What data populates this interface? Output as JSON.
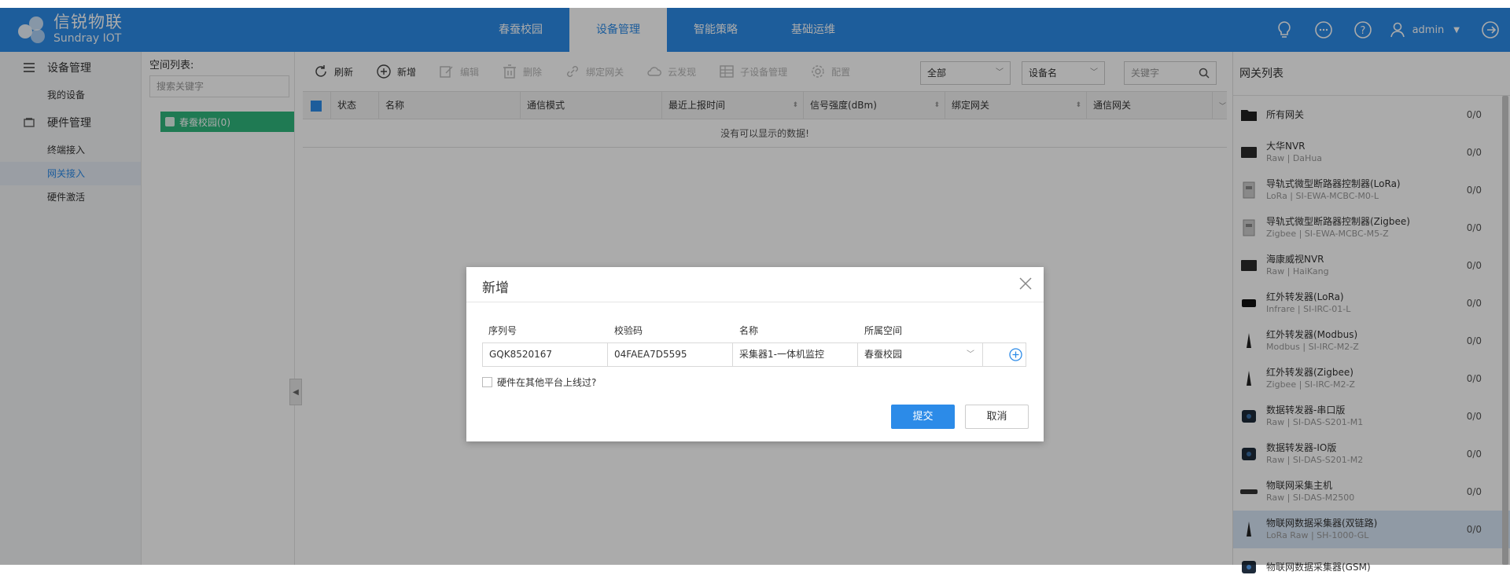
{
  "brand": {
    "name_cn": "信锐物联",
    "name_en": "Sundray IOT"
  },
  "nav": {
    "tabs": [
      "春蚕校园",
      "设备管理",
      "智能策略",
      "基础运维"
    ],
    "active": 1
  },
  "user": {
    "name": "admin"
  },
  "sidebar": {
    "groups": [
      {
        "label": "设备管理",
        "items": [
          "我的设备"
        ]
      },
      {
        "label": "硬件管理",
        "items": [
          "终端接入",
          "网关接入",
          "硬件激活"
        ]
      }
    ],
    "active_item": "网关接入"
  },
  "tree": {
    "title": "空间列表:",
    "search_placeholder": "搜索关键字",
    "node": "春蚕校园(0)"
  },
  "toolbar": {
    "refresh": "刷新",
    "add": "新增",
    "edit": "编辑",
    "delete": "删除",
    "bind_gateway": "绑定网关",
    "cloud_issue": "云发现",
    "sub_device": "子设备管理",
    "config": "配置",
    "filter_all": "全部",
    "filter_field": "设备名",
    "keyword_placeholder": "关键字"
  },
  "table": {
    "columns": [
      "状态",
      "名称",
      "通信模式",
      "最近上报时间",
      "信号强度(dBm)",
      "绑定网关",
      "通信网关"
    ],
    "empty_text": "没有可以显示的数据!"
  },
  "gateway_panel": {
    "title": "网关列表",
    "items": [
      {
        "name": "所有网关",
        "sub": "",
        "count": "0/0"
      },
      {
        "name": "大华NVR",
        "sub": "Raw | DaHua",
        "count": "0/0"
      },
      {
        "name": "导轨式微型断路器控制器(LoRa)",
        "sub": "LoRa | SI-EWA-MCBC-M0-L",
        "count": "0/0"
      },
      {
        "name": "导轨式微型断路器控制器(Zigbee)",
        "sub": "Zigbee | SI-EWA-MCBC-M5-Z",
        "count": "0/0"
      },
      {
        "name": "海康威视NVR",
        "sub": "Raw | HaiKang",
        "count": "0/0"
      },
      {
        "name": "红外转发器(LoRa)",
        "sub": "Infrare | SI-IRC-01-L",
        "count": "0/0"
      },
      {
        "name": "红外转发器(Modbus)",
        "sub": "Modbus | SI-IRC-M2-Z",
        "count": "0/0"
      },
      {
        "name": "红外转发器(Zigbee)",
        "sub": "Zigbee | SI-IRC-M2-Z",
        "count": "0/0"
      },
      {
        "name": "数据转发器-串口版",
        "sub": "Raw | SI-DAS-S201-M1",
        "count": "0/0"
      },
      {
        "name": "数据转发器-IO版",
        "sub": "Raw | SI-DAS-S201-M2",
        "count": "0/0"
      },
      {
        "name": "物联网采集主机",
        "sub": "Raw | SI-DAS-M2500",
        "count": "0/0"
      },
      {
        "name": "物联网数据采集器(双链路)",
        "sub": "LoRa Raw | SH-1000-GL",
        "count": "0/0"
      },
      {
        "name": "物联网数据采集器(GSM)",
        "sub": "",
        "count": ""
      }
    ],
    "selected": 11
  },
  "dialog": {
    "title": "新增",
    "labels": {
      "serial": "序列号",
      "code": "校验码",
      "name": "名称",
      "space": "所属空间"
    },
    "values": {
      "serial": "GQK8520167",
      "code": "04FAEA7D5595",
      "name": "采集器1-一体机监控",
      "space": "春蚕校园"
    },
    "checkbox_label": "硬件在其他平台上线过?",
    "submit": "提交",
    "cancel": "取消"
  },
  "colors": {
    "primary": "#2c8be8",
    "tree_node": "#2fb67c"
  }
}
